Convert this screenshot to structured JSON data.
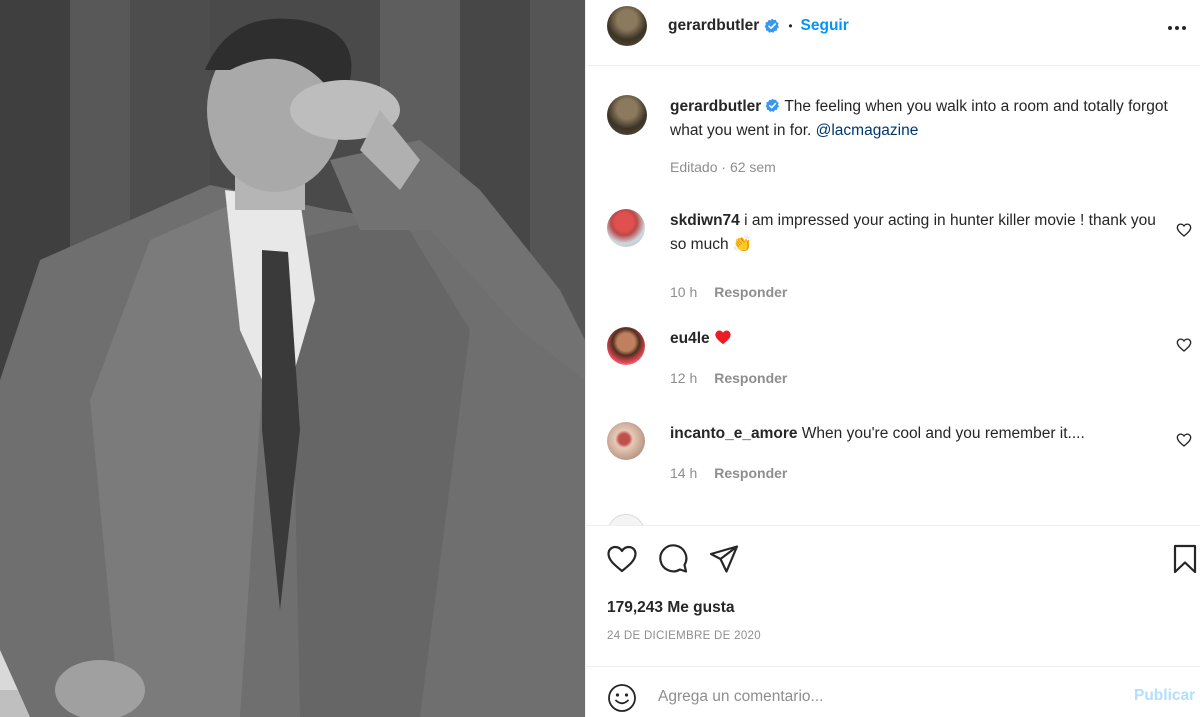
{
  "post": {
    "author": "gerardbutler",
    "follow_label": "Seguir",
    "separator": "•"
  },
  "caption": {
    "username": "gerardbutler",
    "text_before": " The feeling when you walk into a room and totally forgot what you went in for. ",
    "mention": "@lacmagazine",
    "status": "Editado",
    "dot": "·",
    "age": "62 sem"
  },
  "comments": [
    {
      "username": "skdiwn74",
      "text": " i am impressed your acting in hunter killer movie ! thank you so much ",
      "emoji": "👏",
      "time": "10 h",
      "reply": "Responder"
    },
    {
      "username": "eu4le",
      "text": " ",
      "emoji": "❤️",
      "time": "12 h",
      "reply": "Responder"
    },
    {
      "username": "incanto_e_amore",
      "text": " When you're cool and you remember it....",
      "emoji": "",
      "time": "14 h",
      "reply": "Responder"
    }
  ],
  "stats": {
    "likes": "179,243 Me gusta",
    "date": "24 DE DICIEMBRE DE 2020"
  },
  "composer": {
    "placeholder": "Agrega un comentario...",
    "publish_label": "Publicar"
  },
  "icons": {
    "verified": "verified-badge-icon",
    "more": "more-options-icon",
    "like": "heart-icon",
    "comment": "comment-bubble-icon",
    "share": "paper-plane-icon",
    "save": "bookmark-icon",
    "emoji": "emoji-smiley-icon"
  },
  "colors": {
    "accent": "#0095f6",
    "verified": "#3897f0",
    "text": "#262626",
    "muted": "#8e8e8e",
    "link": "#00376b",
    "publish_disabled": "#b2dffc",
    "heart": "#ed4956"
  }
}
